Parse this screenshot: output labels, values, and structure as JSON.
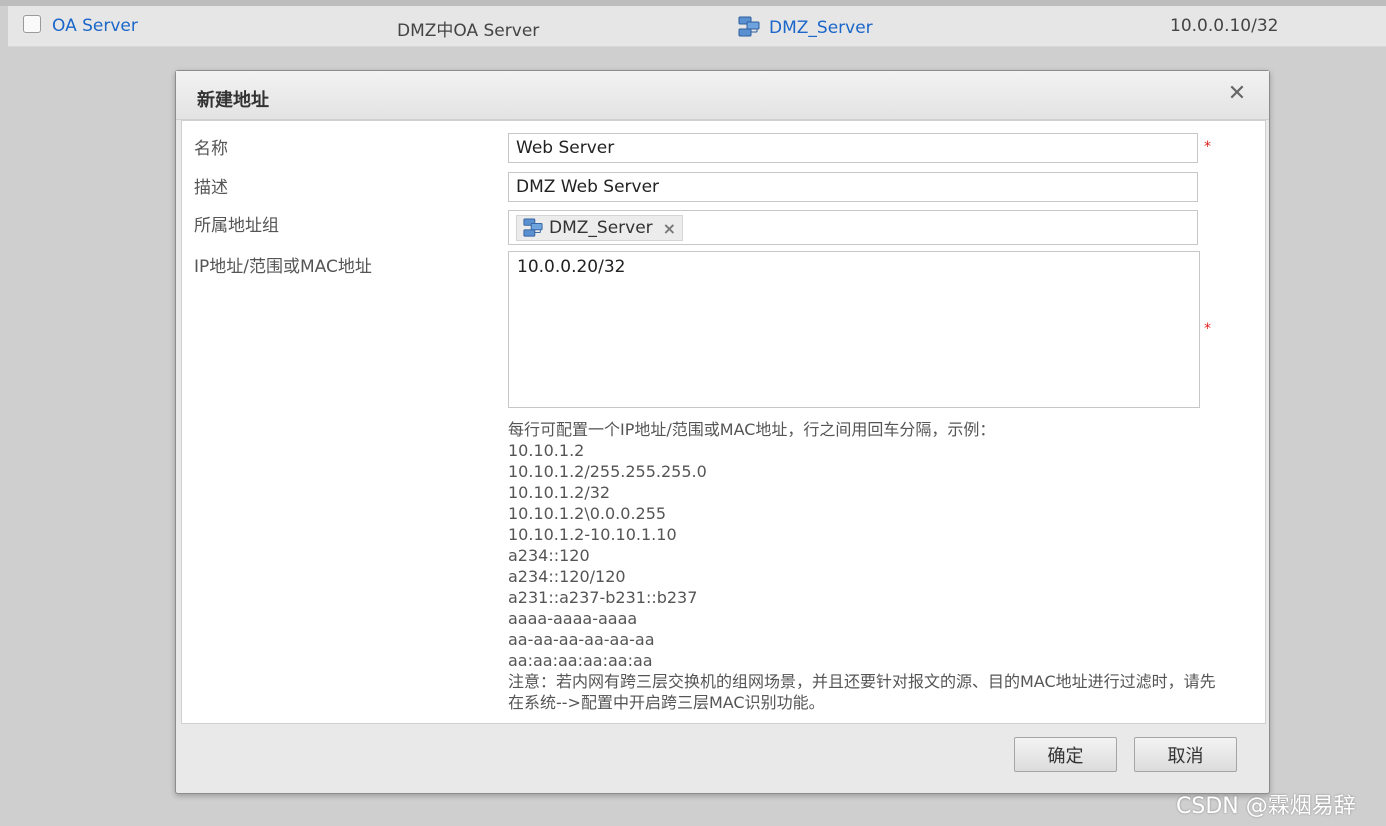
{
  "background_row": {
    "name": "OA Server",
    "description": "DMZ中OA Server",
    "group": "DMZ_Server",
    "group_icon": "server-group-icon",
    "ip": "10.0.0.10/32"
  },
  "dialog": {
    "title": "新建地址",
    "close_icon": "close-icon",
    "labels": {
      "name": "名称",
      "description": "描述",
      "group": "所属地址组",
      "ip": "IP地址/范围或MAC地址"
    },
    "fields": {
      "name_value": "Web Server",
      "description_value": "DMZ Web Server",
      "group_tag": "DMZ_Server",
      "group_tag_icon": "server-group-icon",
      "group_tag_remove": "×",
      "ip_value": "10.0.0.20/32"
    },
    "required_mark": "*",
    "help": {
      "intro": "每行可配置一个IP地址/范围或MAC地址，行之间用回车分隔，示例：",
      "examples": [
        "10.10.1.2",
        "10.10.1.2/255.255.255.0",
        "10.10.1.2/32",
        "10.10.1.2\\0.0.0.255",
        "10.10.1.2-10.10.1.10",
        "a234::120",
        "a234::120/120",
        "a231::a237-b231::b237",
        "aaaa-aaaa-aaaa",
        "aa-aa-aa-aa-aa-aa",
        "aa:aa:aa:aa:aa:aa"
      ],
      "note": "注意：若内网有跨三层交换机的组网场景，并且还要针对报文的源、目的MAC地址进行过滤时，请先在系统-->配置中开启跨三层MAC识别功能。"
    },
    "buttons": {
      "ok": "确定",
      "cancel": "取消"
    }
  },
  "watermark": "CSDN @霖烟易辞",
  "colors": {
    "link": "#1a66c9",
    "required": "#e02020"
  }
}
